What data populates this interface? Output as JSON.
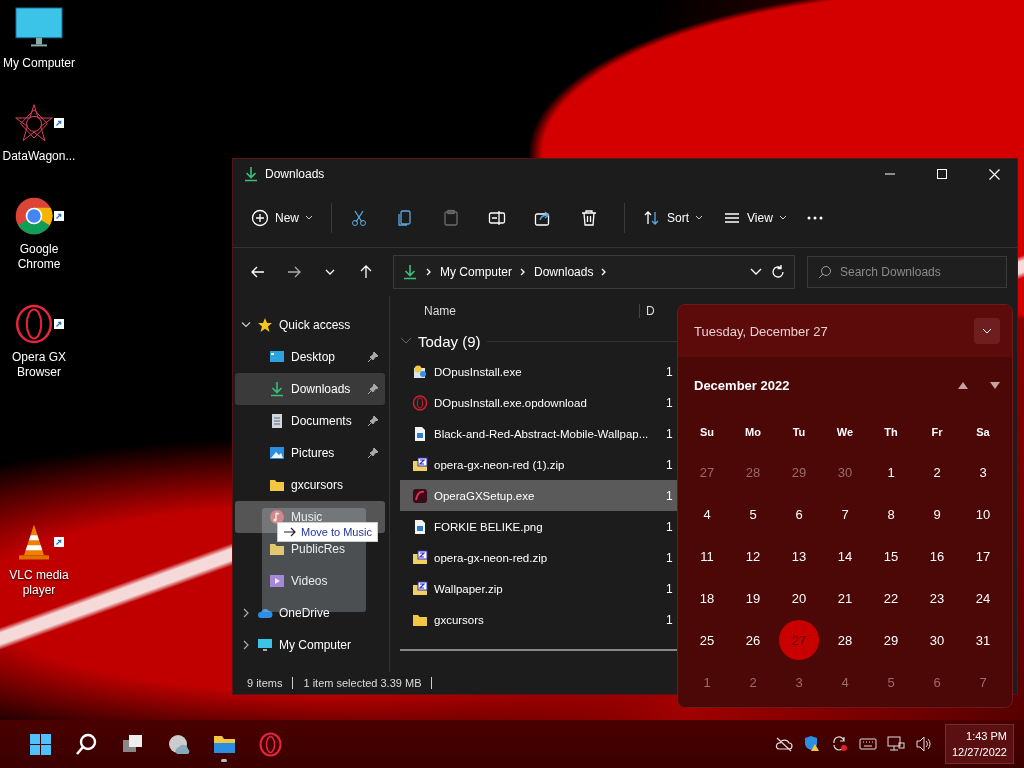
{
  "desktop_icons": [
    {
      "kind": "monitor",
      "label": "My Computer",
      "shortcut": false
    },
    {
      "kind": "mandala",
      "label": "DataWagon...",
      "shortcut": true
    },
    {
      "kind": "chrome",
      "label": "Google Chrome",
      "shortcut": true
    },
    {
      "kind": "opera",
      "label": "Opera GX Browser",
      "shortcut": true
    },
    {
      "kind": "vlc",
      "label": "VLC media player",
      "shortcut": true
    }
  ],
  "window": {
    "title": "Downloads",
    "toolbar": [
      {
        "kind": "new",
        "label": "New",
        "dropdown": true,
        "disabled": false
      },
      {
        "kind": "cut",
        "disabled": false
      },
      {
        "kind": "copy",
        "disabled": false
      },
      {
        "kind": "paste",
        "disabled": true
      },
      {
        "kind": "rename",
        "disabled": false
      },
      {
        "kind": "share",
        "disabled": false
      },
      {
        "kind": "delete",
        "disabled": false
      },
      {
        "kind": "sort",
        "label": "Sort",
        "dropdown": true,
        "disabled": false
      },
      {
        "kind": "view",
        "label": "View",
        "dropdown": true,
        "disabled": false
      },
      {
        "kind": "more",
        "disabled": false
      }
    ],
    "breadcrumb": [
      "My Computer",
      "Downloads"
    ],
    "search": {
      "placeholder": "Search Downloads"
    },
    "nav": [
      {
        "kind": "star",
        "label": "Quick access",
        "expanded": true,
        "selected": false,
        "children": [
          {
            "kind": "desktop",
            "label": "Desktop",
            "pinned": true,
            "selected": false,
            "drop_target": false
          },
          {
            "kind": "download",
            "label": "Downloads",
            "pinned": true,
            "selected": true,
            "drop_target": false
          },
          {
            "kind": "documents",
            "label": "Documents",
            "pinned": true,
            "selected": false,
            "drop_target": false
          },
          {
            "kind": "pictures",
            "label": "Pictures",
            "pinned": true,
            "selected": false,
            "drop_target": false
          },
          {
            "kind": "folder",
            "label": "gxcursors",
            "pinned": false,
            "selected": false,
            "drop_target": false
          },
          {
            "kind": "music",
            "label": "Music",
            "pinned": false,
            "selected": false,
            "drop_target": true
          },
          {
            "kind": "folder",
            "label": "PublicRes",
            "pinned": false,
            "selected": false,
            "drop_target": false
          },
          {
            "kind": "videos",
            "label": "Videos",
            "pinned": false,
            "selected": false,
            "drop_target": false
          }
        ]
      },
      {
        "kind": "cloud",
        "label": "OneDrive",
        "expanded": false,
        "selected": false
      },
      {
        "kind": "monitor",
        "label": "My Computer",
        "expanded": false,
        "selected": false
      }
    ],
    "drag_tooltip": "Move to Music",
    "columns": [
      "Name",
      "D"
    ],
    "group": {
      "label": "Today (9)",
      "expanded": true
    },
    "files": [
      {
        "kind": "installer",
        "name": "DOpusInstall.exe",
        "column_2": "1",
        "selected": false
      },
      {
        "kind": "opera",
        "name": "DOpusInstall.exe.opdownload",
        "column_2": "1",
        "selected": false
      },
      {
        "kind": "image",
        "name": "Black-and-Red-Abstract-Mobile-Wallpap...",
        "column_2": "1",
        "selected": false
      },
      {
        "kind": "zip",
        "name": "opera-gx-neon-red (1).zip",
        "column_2": "1",
        "selected": false
      },
      {
        "kind": "opera_setup",
        "name": "OperaGXSetup.exe",
        "column_2": "1",
        "selected": true
      },
      {
        "kind": "image",
        "name": "FORKIE BELIKE.png",
        "column_2": "1",
        "selected": false
      },
      {
        "kind": "zip",
        "name": "opera-gx-neon-red.zip",
        "column_2": "1",
        "selected": false
      },
      {
        "kind": "zip",
        "name": "Wallpaper.zip",
        "column_2": "1",
        "selected": false
      },
      {
        "kind": "folder",
        "name": "gxcursors",
        "column_2": "1",
        "selected": false
      }
    ],
    "status_bar": {
      "count": "9 items",
      "selection": "1 item selected  3.39 MB"
    }
  },
  "calendar": {
    "header": "Tuesday, December 27",
    "month": "December 2022",
    "weekdays": [
      "Su",
      "Mo",
      "Tu",
      "We",
      "Th",
      "Fr",
      "Sa"
    ],
    "days": [
      {
        "label": "27",
        "kind": "other",
        "selected": false
      },
      {
        "label": "28",
        "kind": "other",
        "selected": false
      },
      {
        "label": "29",
        "kind": "other",
        "selected": false
      },
      {
        "label": "30",
        "kind": "other",
        "selected": false
      },
      {
        "label": "1",
        "kind": "current",
        "selected": false
      },
      {
        "label": "2",
        "kind": "current",
        "selected": false
      },
      {
        "label": "3",
        "kind": "current",
        "selected": false
      },
      {
        "label": "4",
        "kind": "current",
        "selected": false
      },
      {
        "label": "5",
        "kind": "current",
        "selected": false
      },
      {
        "label": "6",
        "kind": "current",
        "selected": false
      },
      {
        "label": "7",
        "kind": "current",
        "selected": false
      },
      {
        "label": "8",
        "kind": "current",
        "selected": false
      },
      {
        "label": "9",
        "kind": "current",
        "selected": false
      },
      {
        "label": "10",
        "kind": "current",
        "selected": false
      },
      {
        "label": "11",
        "kind": "current",
        "selected": false
      },
      {
        "label": "12",
        "kind": "current",
        "selected": false
      },
      {
        "label": "13",
        "kind": "current",
        "selected": false
      },
      {
        "label": "14",
        "kind": "current",
        "selected": false
      },
      {
        "label": "15",
        "kind": "current",
        "selected": false
      },
      {
        "label": "16",
        "kind": "current",
        "selected": false
      },
      {
        "label": "17",
        "kind": "current",
        "selected": false
      },
      {
        "label": "18",
        "kind": "current",
        "selected": false
      },
      {
        "label": "19",
        "kind": "current",
        "selected": false
      },
      {
        "label": "20",
        "kind": "current",
        "selected": false
      },
      {
        "label": "21",
        "kind": "current",
        "selected": false
      },
      {
        "label": "22",
        "kind": "current",
        "selected": false
      },
      {
        "label": "23",
        "kind": "current",
        "selected": false
      },
      {
        "label": "24",
        "kind": "current",
        "selected": false
      },
      {
        "label": "25",
        "kind": "current",
        "selected": false
      },
      {
        "label": "26",
        "kind": "current",
        "selected": false
      },
      {
        "label": "27",
        "kind": "current",
        "selected": true
      },
      {
        "label": "28",
        "kind": "current",
        "selected": false
      },
      {
        "label": "29",
        "kind": "current",
        "selected": false
      },
      {
        "label": "30",
        "kind": "current",
        "selected": false
      },
      {
        "label": "31",
        "kind": "current",
        "selected": false
      },
      {
        "label": "1",
        "kind": "other",
        "selected": false
      },
      {
        "label": "2",
        "kind": "other",
        "selected": false
      },
      {
        "label": "3",
        "kind": "other",
        "selected": false
      },
      {
        "label": "4",
        "kind": "other",
        "selected": false
      },
      {
        "label": "5",
        "kind": "other",
        "selected": false
      },
      {
        "label": "6",
        "kind": "other",
        "selected": false
      },
      {
        "label": "7",
        "kind": "other",
        "selected": false
      }
    ]
  },
  "taskbar": {
    "apps": [
      {
        "kind": "start",
        "running": false
      },
      {
        "kind": "search",
        "running": false
      },
      {
        "kind": "taskview",
        "running": false
      },
      {
        "kind": "weather",
        "running": false
      },
      {
        "kind": "explorer",
        "running": true
      },
      {
        "kind": "opera",
        "running": false
      }
    ],
    "tray": [
      {
        "kind": "network-off"
      },
      {
        "kind": "security"
      },
      {
        "kind": "sync"
      },
      {
        "kind": "keyboard"
      },
      {
        "kind": "ethernet"
      },
      {
        "kind": "volume"
      }
    ],
    "time": "1:43 PM",
    "date": "12/27/2022"
  }
}
